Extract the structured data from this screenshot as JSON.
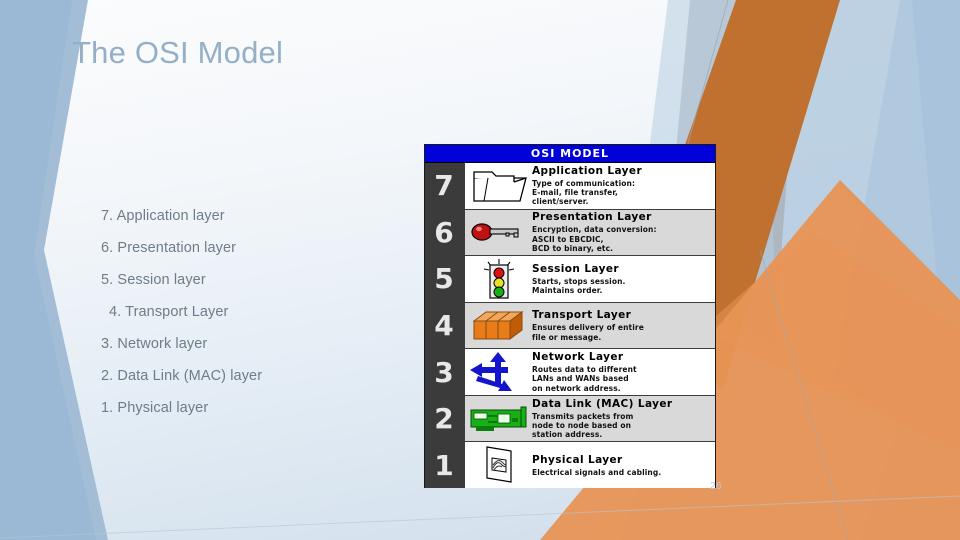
{
  "slide": {
    "title": "The OSI Model",
    "page_number": "26",
    "title_color": "#95afc7",
    "accent_orange": "#cd7430",
    "accent_blue": "#9bb8d4"
  },
  "bullets": [
    {
      "text": "7. Application layer",
      "indent": false
    },
    {
      "text": "6. Presentation layer",
      "indent": false
    },
    {
      "text": "5. Session layer",
      "indent": false
    },
    {
      "text": "4. Transport Layer",
      "indent": true
    },
    {
      "text": "3. Network layer",
      "indent": false
    },
    {
      "text": "2. Data Link (MAC) layer",
      "indent": false
    },
    {
      "text": "1. Physical layer",
      "indent": false
    }
  ],
  "osi_table": {
    "header": "OSI MODEL",
    "header_bg": "#0000d8",
    "number_column_bg": "#3b3b3b",
    "rows": [
      {
        "number": "7",
        "title": "Application Layer",
        "desc": "Type of communication:\nE-mail, file transfer,\nclient/server.",
        "icon": "folder-icon",
        "shaded": false
      },
      {
        "number": "6",
        "title": "Presentation Layer",
        "desc": "Encryption, data conversion:\nASCII to EBCDIC,\nBCD to binary, etc.",
        "icon": "key-icon",
        "shaded": true
      },
      {
        "number": "5",
        "title": "Session Layer",
        "desc": "Starts, stops session.\nMaintains order.",
        "icon": "traffic-light-icon",
        "shaded": false
      },
      {
        "number": "4",
        "title": "Transport Layer",
        "desc": "Ensures delivery of entire\nfile or message.",
        "icon": "boxes-icon",
        "shaded": true
      },
      {
        "number": "3",
        "title": "Network Layer",
        "desc": "Routes data to different\nLANs and WANs based\non network address.",
        "icon": "arrows-icon",
        "shaded": false
      },
      {
        "number": "2",
        "title": "Data Link (MAC) Layer",
        "desc": "Transmits packets from\nnode to node based on\nstation address.",
        "icon": "network-card-icon",
        "shaded": true
      },
      {
        "number": "1",
        "title": "Physical Layer",
        "desc": "Electrical signals and cabling.",
        "icon": "wall-plate-icon",
        "shaded": false
      }
    ]
  }
}
